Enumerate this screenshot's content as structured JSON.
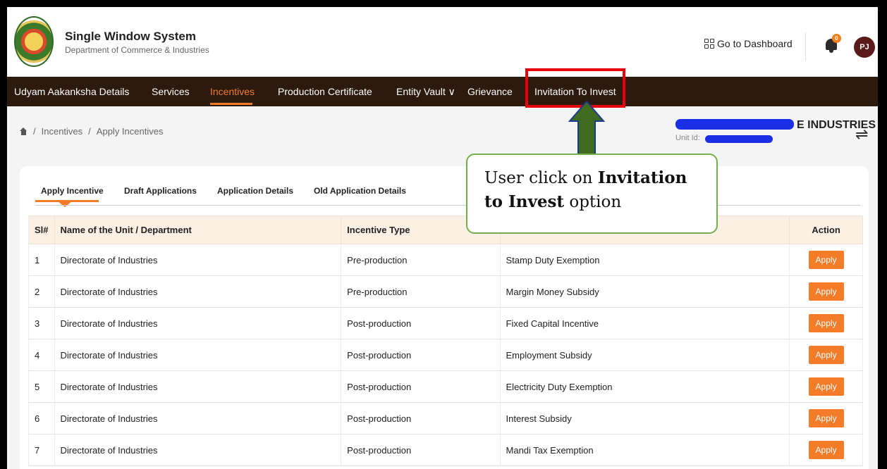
{
  "header": {
    "title": "Single Window System",
    "subtitle": "Department of Commerce & Industries",
    "dashboard_link": "Go to Dashboard",
    "notification_count": "0",
    "avatar_initials": "PJ"
  },
  "nav": {
    "items": [
      "Udyam Aakanksha Details",
      "Services",
      "Incentives",
      "Production Certificate",
      "Entity Vault ∨",
      "Grievance",
      "Invitation To Invest"
    ],
    "active": "Incentives"
  },
  "breadcrumb": {
    "items": [
      "Incentives",
      "Apply Incentives"
    ]
  },
  "entity": {
    "name_visible": "E INDUSTRIES",
    "unit_label": "Unit Id:"
  },
  "tabs": [
    "Apply Incentive",
    "Draft Applications",
    "Application Details",
    "Old Application Details"
  ],
  "table": {
    "headers": [
      "Sl#",
      "Name of the Unit / Department",
      "Incentive Type",
      "",
      "Action"
    ],
    "rows": [
      [
        "1",
        "Directorate of Industries",
        "Pre-production",
        "Stamp Duty Exemption",
        "Apply"
      ],
      [
        "2",
        "Directorate of Industries",
        "Pre-production",
        "Margin Money Subsidy",
        "Apply"
      ],
      [
        "3",
        "Directorate of Industries",
        "Post-production",
        "Fixed Capital Incentive",
        "Apply"
      ],
      [
        "4",
        "Directorate of Industries",
        "Post-production",
        "Employment Subsidy",
        "Apply"
      ],
      [
        "5",
        "Directorate of Industries",
        "Post-production",
        "Electricity Duty Exemption",
        "Apply"
      ],
      [
        "6",
        "Directorate of Industries",
        "Post-production",
        "Interest Subsidy",
        "Apply"
      ],
      [
        "7",
        "Directorate of Industries",
        "Post-production",
        "Mandi Tax Exemption",
        "Apply"
      ]
    ]
  },
  "annotation": {
    "text_before": "User click on ",
    "text_bold": "Invitation to Invest",
    "text_after": " option"
  },
  "colors": {
    "accent": "#f47b28",
    "nav_bg": "#2b1a0d",
    "highlight": "#e8000b",
    "callout_border": "#74b04a",
    "arrow": "#3e6b1f"
  }
}
